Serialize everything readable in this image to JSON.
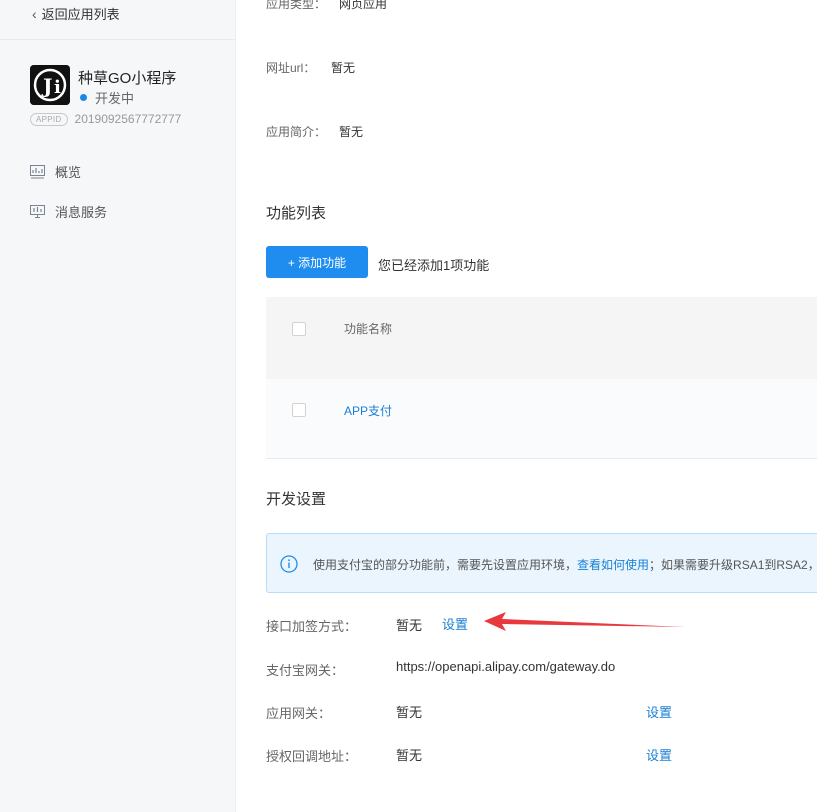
{
  "sidebar": {
    "back_label": "返回应用列表",
    "app": {
      "name": "种草GO小程序",
      "status": "开发中",
      "appid_badge": "APPID",
      "appid": "2019092567772777",
      "logo_text": "Ji"
    },
    "items": [
      {
        "label": "概览",
        "icon": "chart-icon"
      },
      {
        "label": "消息服务",
        "icon": "monitor-icon"
      }
    ]
  },
  "main": {
    "info_rows": [
      {
        "label": "应用类型：",
        "value": "网页应用"
      },
      {
        "label": "网址url：",
        "value": "暂无"
      },
      {
        "label": "应用简介：",
        "value": "暂无"
      }
    ],
    "features": {
      "title": "功能列表",
      "add_button": "+ 添加功能",
      "added_text": "您已经添加1项功能",
      "column_header": "功能名称",
      "rows": [
        {
          "name": "APP支付"
        }
      ]
    },
    "dev_settings": {
      "title": "开发设置",
      "notice": {
        "text_before": "使用支付宝的部分功能前，需要先设置应用环境，",
        "link": "查看如何使用",
        "text_after": "；如果需要升级RSA1到RSA2，"
      },
      "rows": [
        {
          "label": "接口加签方式：",
          "value": "暂无",
          "action": "设置"
        },
        {
          "label": "支付宝网关：",
          "value": "https://openapi.alipay.com/gateway.do"
        },
        {
          "label": "应用网关：",
          "value": "暂无",
          "action": "设置"
        },
        {
          "label": "授权回调地址：",
          "value": "暂无",
          "action": "设置"
        }
      ]
    }
  },
  "colors": {
    "primary": "#1f8df0",
    "link": "#1a7fd4",
    "annotation_arrow": "#e8393c",
    "status_dot": "#1a88e8"
  }
}
